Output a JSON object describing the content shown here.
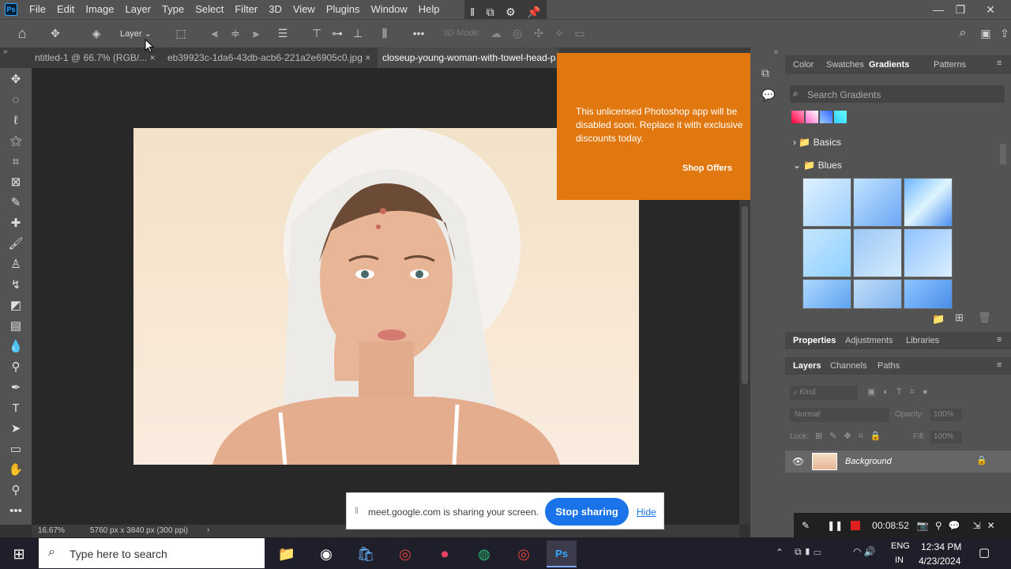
{
  "menubar": {
    "items": [
      "File",
      "Edit",
      "Image",
      "Layer",
      "Type",
      "Select",
      "Filter",
      "3D",
      "View",
      "Plugins",
      "Window",
      "Help"
    ]
  },
  "options": {
    "layer_select": "Layer",
    "mode_3d": "3D Mode:"
  },
  "tabs": [
    {
      "label": "ntitled-1 @ 66.7% (RGB/...",
      "close": "×"
    },
    {
      "label": "eb39923c-1da6-43db-acb6-221a2e6905c0.jpg",
      "close": "×"
    },
    {
      "label": "closeup-young-woman-with-towel-head-p"
    }
  ],
  "promo": {
    "text": "This unlicensed Photoshop app will be disabled soon. Replace it with exclusive discounts today.",
    "button": "Shop Offers"
  },
  "panel_top": {
    "tabs": [
      "Color",
      "Swatches",
      "Gradients",
      "Patterns"
    ],
    "search_placeholder": "Search Gradients",
    "folders": [
      "Basics",
      "Blues"
    ]
  },
  "panel_mid": {
    "tabs": [
      "Properties",
      "Adjustments",
      "Libraries"
    ]
  },
  "panel_layers": {
    "tabs": [
      "Layers",
      "Channels",
      "Paths"
    ],
    "kind": "Kind",
    "blend": "Normal",
    "opacity_label": "Opacity:",
    "opacity_val": "100%",
    "lock_label": "Lock:",
    "fill_label": "Fill:",
    "fill_val": "100%",
    "layer_name": "Background"
  },
  "status": {
    "zoom": "16.67%",
    "doc_info": "5760 px x 3840 px (300 ppi)"
  },
  "meet": {
    "text": "meet.google.com is sharing your screen.",
    "stop": "Stop sharing",
    "hide": "Hide"
  },
  "recorder": {
    "time": "00:08:52"
  },
  "taskbar": {
    "search": "Type here to search",
    "lang1": "ENG",
    "lang2": "IN",
    "time": "12:34 PM",
    "date": "4/23/2024"
  },
  "colors": {
    "promo": "#e0780f",
    "accent": "#1a73e8",
    "photoshop": "#31a8ff"
  }
}
